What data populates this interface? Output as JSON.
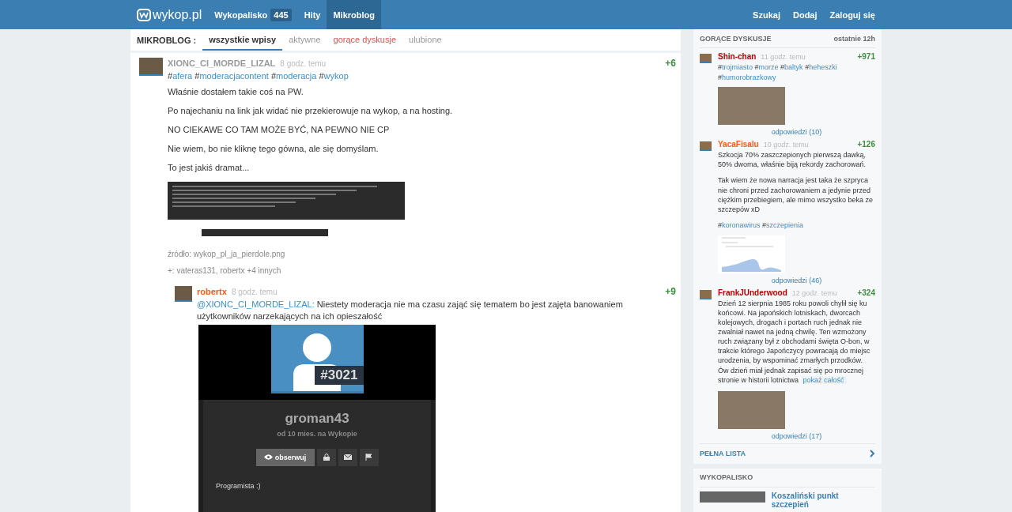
{
  "topbar": {
    "logo": "wykop.pl",
    "nav": [
      {
        "label": "Wykopalisko",
        "badge": "445",
        "selected": false
      },
      {
        "label": "Hity",
        "selected": false
      },
      {
        "label": "Mikroblog",
        "selected": true
      }
    ],
    "actions": [
      "Szukaj",
      "Dodaj",
      "Zaloguj się"
    ]
  },
  "subnav": {
    "label": "MIKROBLOG :",
    "tabs": [
      {
        "label": "wszystkie wpisy",
        "selected": true,
        "kind": "normal"
      },
      {
        "label": "aktywne",
        "selected": false,
        "kind": "normal"
      },
      {
        "label": "gorące dyskusje",
        "selected": false,
        "kind": "hot"
      },
      {
        "label": "ulubione",
        "selected": false,
        "kind": "normal"
      }
    ]
  },
  "entry": {
    "author": "XIONC_CI_MORDE_LIZAL",
    "color": "#999999",
    "time": "8 godz. temu",
    "votes": "+6",
    "tags": [
      "#afera",
      "#moderacjacontent",
      "#moderacja",
      "#wykop"
    ],
    "paragraphs": [
      "Właśnie dostałem takie coś na PW.",
      "Po najechaniu na link jak widać nie przekierowuje na wykop, a na hosting.",
      "NO CIEKAWE CO TAM MOŻE BYĆ, NA PEWNO NIE CP",
      "Nie wiem, bo nie kliknę tego gówna, ale się domyślam.",
      "To jest jakiś dramat..."
    ],
    "source": "źródło: wykop_pl_ja_pierdole.png",
    "voters": "+: vateras131, robertx +4 innych"
  },
  "comment": {
    "author": "robertx",
    "color": "#ff5917",
    "time": "8 godz. temu",
    "votes": "+9",
    "mention": "@XIONC_CI_MORDE_LIZAL:",
    "text": "Niestety moderacja nie ma czasu zająć się tematem bo jest zajęta banowaniem użytkowników narzekających na ich opieszałość",
    "card": {
      "number": "#3021",
      "name": "groman43",
      "since": "od 10 mies. na Wykopie",
      "follow": "obserwuj",
      "bio": "Programista :)"
    }
  },
  "hot": {
    "title": "GORĄCE DYSKUSJE",
    "period": "ostatnie 12h",
    "items": [
      {
        "author": "Shin-chan",
        "color": "#bb0000",
        "time": "11 godz. temu",
        "votes": "+971",
        "tags": [
          "#trojmiasto",
          "#morze",
          "#baltyk",
          "#heheszki",
          "#humorobrazkowy"
        ],
        "kind": "photo",
        "replies": "odpowiedzi (10)"
      },
      {
        "author": "YacaFisalu",
        "color": "#ff5917",
        "time": "10 godz. temu",
        "votes": "+126",
        "paragraphs": [
          "Szkocja 70% zaszczepionych pierwszą dawką, 50% dwoma, właśnie biją rekordy zachorowań.",
          "Tak wiem że nowa narracja jest taka że szpryca nie chroni przed zachorowaniem a jedynie przed ciężkim przebiegiem, ale mimo wszystko beka ze szczepów xD"
        ],
        "tags": [
          "#koronawirus",
          "#szczepienia"
        ],
        "kind": "chart",
        "replies": "odpowiedzi (46)"
      },
      {
        "author": "FrankJUnderwood",
        "color": "#bb0000",
        "time": "12 godz. temu",
        "votes": "+324",
        "paragraphs": [
          "Dzień 12 sierpnia 1985 roku powoli chylił się ku końcowi. Na japońskich lotniskach, dworcach kolejowych, drogach i portach ruch jednak nie zwalniał nawet na jedną chwilę. Ten wzmożony ruch związany był z obchodami święta O-bon, w trakcie którego Japończycy powracają do miejsc urodzenia, by wspominać zmarłych przodków. Ów dzień miał jednak zapisać się po mrocznej stronie w historii lotnictwa"
        ],
        "more": "pokaż całość",
        "kind": "photo",
        "replies": "odpowiedzi (17)"
      }
    ],
    "full_list": "PEŁNA LISTA"
  },
  "digs": {
    "title": "WYKOPALISKO",
    "items": [
      "Koszaliński punkt szczepień"
    ]
  }
}
